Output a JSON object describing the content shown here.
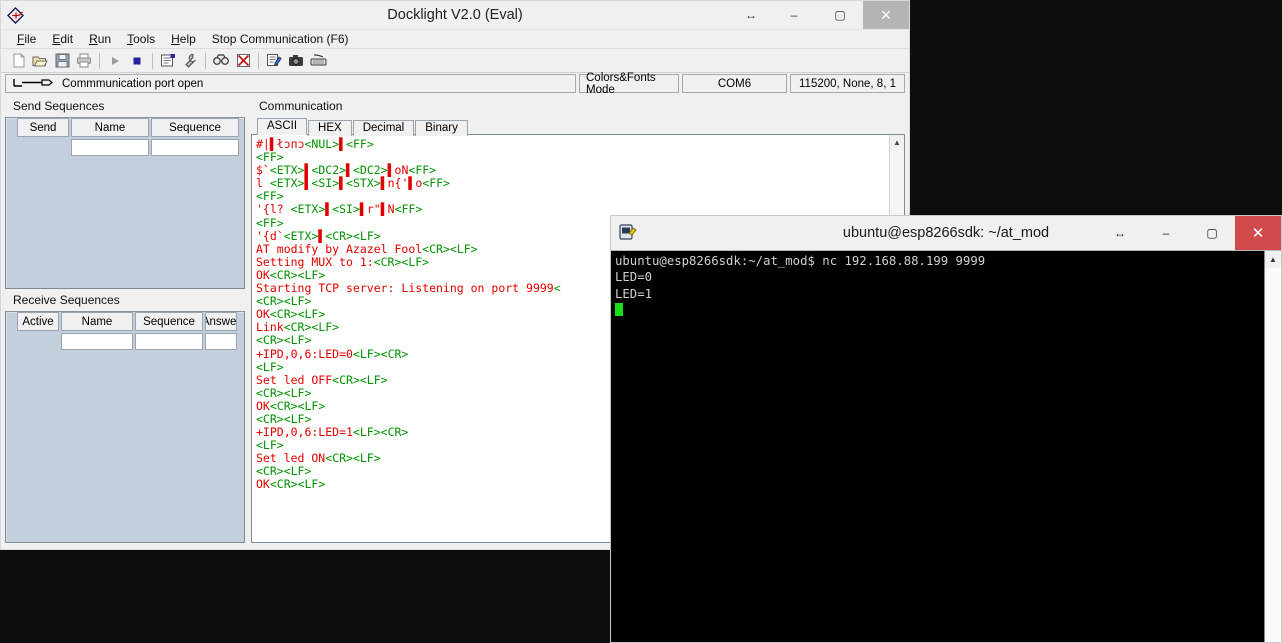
{
  "docklight": {
    "title": "Docklight V2.0 (Eval)",
    "app_icon": "docklight-logo-icon",
    "window_controls": {
      "resize": "resize-icon",
      "minimize": "minimize-icon",
      "maximize": "maximize-icon",
      "close": "close-icon"
    },
    "menu": [
      {
        "label": "File",
        "mnemonic": "F"
      },
      {
        "label": "Edit",
        "mnemonic": "E"
      },
      {
        "label": "Run",
        "mnemonic": "R"
      },
      {
        "label": "Tools",
        "mnemonic": "T"
      },
      {
        "label": "Help",
        "mnemonic": "H"
      },
      {
        "label": "Stop Communication  (F6)",
        "mnemonic": ""
      }
    ],
    "toolbar": [
      "new-file-icon",
      "open-folder-icon",
      "save-icon",
      "print-icon",
      "start-communication-icon",
      "stop-communication-icon",
      "project-settings-icon",
      "tools-wrench-icon",
      "find-icon",
      "clear-communication-icon",
      "edit-log-icon",
      "snapshot-camera-icon",
      "keyboard-console-icon"
    ],
    "status": {
      "port_icon": "serial-port-icon",
      "port_text": "Commmunication port open",
      "colors_fonts_mode": "Colors&Fonts Mode",
      "com_port": "COM6",
      "baud_settings": "115200, None, 8, 1"
    },
    "send_sequences": {
      "label": "Send Sequences",
      "columns": [
        "Send",
        "Name",
        "Sequence"
      ],
      "rows": [
        {
          "send": "",
          "name": "",
          "sequence": ""
        }
      ]
    },
    "receive_sequences": {
      "label": "Receive Sequences",
      "columns": [
        "Active",
        "Name",
        "Sequence",
        "Answer"
      ],
      "rows": [
        {
          "active": "",
          "name": "",
          "sequence": "",
          "answer": ""
        }
      ]
    },
    "communication": {
      "label": "Communication",
      "tabs": [
        {
          "label": "ASCII",
          "active": true
        },
        {
          "label": "HEX",
          "active": false
        },
        {
          "label": "Decimal",
          "active": false
        },
        {
          "label": "Binary",
          "active": false
        }
      ],
      "log_lines": [
        [
          {
            "t": "#|",
            "c": "red"
          },
          {
            "t": "▌",
            "c": "mark"
          },
          {
            "t": "łɔпɔ",
            "c": "red"
          },
          {
            "t": "<NUL>",
            "c": "grn"
          },
          {
            "t": "▌",
            "c": "mark"
          },
          {
            "t": "<FF>",
            "c": "grn"
          }
        ],
        [
          {
            "t": "<FF>",
            "c": "grn"
          }
        ],
        [
          {
            "t": "$`",
            "c": "red"
          },
          {
            "t": "<ETX>",
            "c": "grn"
          },
          {
            "t": "▌",
            "c": "mark"
          },
          {
            "t": "<DC2>",
            "c": "grn"
          },
          {
            "t": "▌",
            "c": "mark"
          },
          {
            "t": "<DC2>",
            "c": "grn"
          },
          {
            "t": "▌",
            "c": "mark"
          },
          {
            "t": "oN",
            "c": "red"
          },
          {
            "t": "<FF>",
            "c": "grn"
          }
        ],
        [
          {
            "t": "l ",
            "c": "red"
          },
          {
            "t": "<ETX>",
            "c": "grn"
          },
          {
            "t": "▌",
            "c": "mark"
          },
          {
            "t": "<SI>",
            "c": "grn"
          },
          {
            "t": "▌",
            "c": "mark"
          },
          {
            "t": "<STX>",
            "c": "grn"
          },
          {
            "t": "▌",
            "c": "mark"
          },
          {
            "t": "n{'",
            "c": "red"
          },
          {
            "t": "▌",
            "c": "mark"
          },
          {
            "t": "o",
            "c": "red"
          },
          {
            "t": "<FF>",
            "c": "grn"
          }
        ],
        [
          {
            "t": "<FF>",
            "c": "grn"
          }
        ],
        [
          {
            "t": "'{l? ",
            "c": "red"
          },
          {
            "t": "<ETX>",
            "c": "grn"
          },
          {
            "t": "▌",
            "c": "mark"
          },
          {
            "t": "<SI>",
            "c": "grn"
          },
          {
            "t": "▌",
            "c": "mark"
          },
          {
            "t": "r\"",
            "c": "red"
          },
          {
            "t": "▌",
            "c": "mark"
          },
          {
            "t": "N",
            "c": "red"
          },
          {
            "t": "<FF>",
            "c": "grn"
          }
        ],
        [
          {
            "t": "<FF>",
            "c": "grn"
          }
        ],
        [
          {
            "t": "'{d`",
            "c": "red"
          },
          {
            "t": "<ETX>",
            "c": "grn"
          },
          {
            "t": "▌",
            "c": "mark"
          },
          {
            "t": "<CR>",
            "c": "grn"
          },
          {
            "t": "<LF>",
            "c": "grn"
          }
        ],
        [
          {
            "t": "AT modify by Azazel Fool",
            "c": "red"
          },
          {
            "t": "<CR>",
            "c": "grn"
          },
          {
            "t": "<LF>",
            "c": "grn"
          }
        ],
        [
          {
            "t": "Setting MUX to 1:",
            "c": "red"
          },
          {
            "t": "<CR>",
            "c": "grn"
          },
          {
            "t": "<LF>",
            "c": "grn"
          }
        ],
        [
          {
            "t": "OK",
            "c": "red"
          },
          {
            "t": "<CR>",
            "c": "grn"
          },
          {
            "t": "<LF>",
            "c": "grn"
          }
        ],
        [
          {
            "t": "Starting TCP server: Listening on port 9999",
            "c": "red"
          },
          {
            "t": "<",
            "c": "grn"
          }
        ],
        [
          {
            "t": "<CR>",
            "c": "grn"
          },
          {
            "t": "<LF>",
            "c": "grn"
          }
        ],
        [
          {
            "t": "OK",
            "c": "red"
          },
          {
            "t": "<CR>",
            "c": "grn"
          },
          {
            "t": "<LF>",
            "c": "grn"
          }
        ],
        [
          {
            "t": "Link",
            "c": "red"
          },
          {
            "t": "<CR>",
            "c": "grn"
          },
          {
            "t": "<LF>",
            "c": "grn"
          }
        ],
        [
          {
            "t": "<CR>",
            "c": "grn"
          },
          {
            "t": "<LF>",
            "c": "grn"
          }
        ],
        [
          {
            "t": "+IPD,0,6:LED=0",
            "c": "red"
          },
          {
            "t": "<LF>",
            "c": "grn"
          },
          {
            "t": "<CR>",
            "c": "grn"
          }
        ],
        [
          {
            "t": "<LF>",
            "c": "grn"
          }
        ],
        [
          {
            "t": "Set led OFF",
            "c": "red"
          },
          {
            "t": "<CR>",
            "c": "grn"
          },
          {
            "t": "<LF>",
            "c": "grn"
          }
        ],
        [
          {
            "t": "<CR>",
            "c": "grn"
          },
          {
            "t": "<LF>",
            "c": "grn"
          }
        ],
        [
          {
            "t": "OK",
            "c": "red"
          },
          {
            "t": "<CR>",
            "c": "grn"
          },
          {
            "t": "<LF>",
            "c": "grn"
          }
        ],
        [
          {
            "t": "<CR>",
            "c": "grn"
          },
          {
            "t": "<LF>",
            "c": "grn"
          }
        ],
        [
          {
            "t": "+IPD,0,6:LED=1",
            "c": "red"
          },
          {
            "t": "<LF>",
            "c": "grn"
          },
          {
            "t": "<CR>",
            "c": "grn"
          }
        ],
        [
          {
            "t": "<LF>",
            "c": "grn"
          }
        ],
        [
          {
            "t": "Set led ON",
            "c": "red"
          },
          {
            "t": "<CR>",
            "c": "grn"
          },
          {
            "t": "<LF>",
            "c": "grn"
          }
        ],
        [
          {
            "t": "<CR>",
            "c": "grn"
          },
          {
            "t": "<LF>",
            "c": "grn"
          }
        ],
        [
          {
            "t": "OK",
            "c": "red"
          },
          {
            "t": "<CR>",
            "c": "grn"
          },
          {
            "t": "<LF>",
            "c": "grn"
          }
        ]
      ],
      "scrollbar": {
        "up_arrow": "scroll-up-icon"
      }
    }
  },
  "terminal": {
    "title": "ubuntu@esp8266sdk: ~/at_mod",
    "app_icon": "putty-icon",
    "window_controls": {
      "resize": "resize-icon",
      "minimize": "minimize-icon",
      "maximize": "maximize-icon",
      "close": "close-icon"
    },
    "lines": [
      "ubuntu@esp8266sdk:~/at_mod$ nc 192.168.88.199 9999",
      "LED=0",
      "LED=1"
    ],
    "cursor": "block-cursor",
    "scrollbar": {
      "up_arrow": "scroll-up-icon"
    }
  },
  "colors": {
    "log_sent": "#e00000",
    "log_control": "#009000",
    "terminal_bg": "#000000",
    "terminal_fg": "#cfcfcf",
    "terminal_cursor": "#19e019",
    "close_button": "#d04c4c",
    "grid_bg": "#c3cfdd"
  }
}
